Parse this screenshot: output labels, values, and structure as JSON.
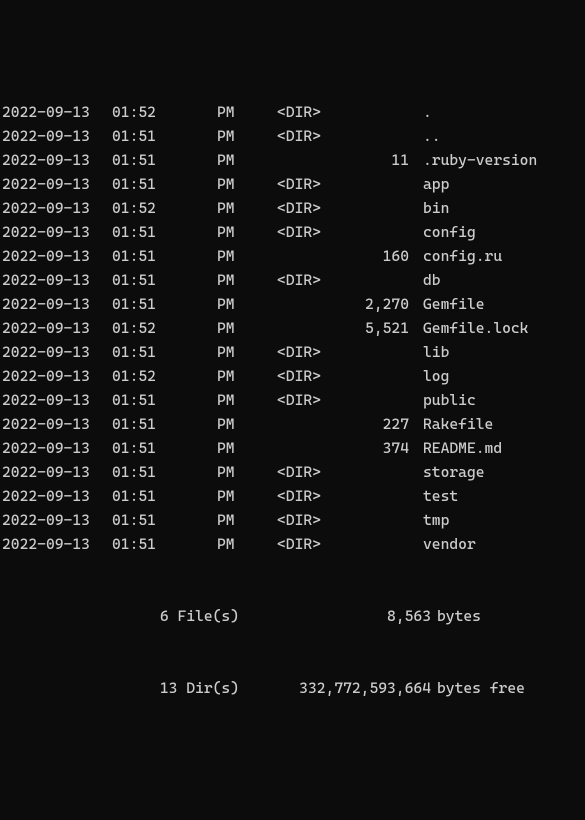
{
  "entries": [
    {
      "date": "2022-09-13",
      "time": "01:52",
      "ampm": "PM",
      "flag": "<DIR>",
      "size": "",
      "name": "."
    },
    {
      "date": "2022-09-13",
      "time": "01:51",
      "ampm": "PM",
      "flag": "<DIR>",
      "size": "",
      "name": ".."
    },
    {
      "date": "2022-09-13",
      "time": "01:51",
      "ampm": "PM",
      "flag": "",
      "size": "11",
      "name": ".ruby-version"
    },
    {
      "date": "2022-09-13",
      "time": "01:51",
      "ampm": "PM",
      "flag": "<DIR>",
      "size": "",
      "name": "app"
    },
    {
      "date": "2022-09-13",
      "time": "01:52",
      "ampm": "PM",
      "flag": "<DIR>",
      "size": "",
      "name": "bin"
    },
    {
      "date": "2022-09-13",
      "time": "01:51",
      "ampm": "PM",
      "flag": "<DIR>",
      "size": "",
      "name": "config"
    },
    {
      "date": "2022-09-13",
      "time": "01:51",
      "ampm": "PM",
      "flag": "",
      "size": "160",
      "name": "config.ru"
    },
    {
      "date": "2022-09-13",
      "time": "01:51",
      "ampm": "PM",
      "flag": "<DIR>",
      "size": "",
      "name": "db"
    },
    {
      "date": "2022-09-13",
      "time": "01:51",
      "ampm": "PM",
      "flag": "",
      "size": "2,270",
      "name": "Gemfile"
    },
    {
      "date": "2022-09-13",
      "time": "01:52",
      "ampm": "PM",
      "flag": "",
      "size": "5,521",
      "name": "Gemfile.lock"
    },
    {
      "date": "2022-09-13",
      "time": "01:51",
      "ampm": "PM",
      "flag": "<DIR>",
      "size": "",
      "name": "lib"
    },
    {
      "date": "2022-09-13",
      "time": "01:52",
      "ampm": "PM",
      "flag": "<DIR>",
      "size": "",
      "name": "log"
    },
    {
      "date": "2022-09-13",
      "time": "01:51",
      "ampm": "PM",
      "flag": "<DIR>",
      "size": "",
      "name": "public"
    },
    {
      "date": "2022-09-13",
      "time": "01:51",
      "ampm": "PM",
      "flag": "",
      "size": "227",
      "name": "Rakefile"
    },
    {
      "date": "2022-09-13",
      "time": "01:51",
      "ampm": "PM",
      "flag": "",
      "size": "374",
      "name": "README.md"
    },
    {
      "date": "2022-09-13",
      "time": "01:51",
      "ampm": "PM",
      "flag": "<DIR>",
      "size": "",
      "name": "storage"
    },
    {
      "date": "2022-09-13",
      "time": "01:51",
      "ampm": "PM",
      "flag": "<DIR>",
      "size": "",
      "name": "test"
    },
    {
      "date": "2022-09-13",
      "time": "01:51",
      "ampm": "PM",
      "flag": "<DIR>",
      "size": "",
      "name": "tmp"
    },
    {
      "date": "2022-09-13",
      "time": "01:51",
      "ampm": "PM",
      "flag": "<DIR>",
      "size": "",
      "name": "vendor"
    }
  ],
  "summary": {
    "files_count": "6 File(s)",
    "files_bytes": "8,563",
    "files_bytes_label": "bytes",
    "dirs_count": "13 Dir(s)",
    "dirs_bytes": "332,772,593,664",
    "dirs_bytes_label": "bytes free"
  }
}
